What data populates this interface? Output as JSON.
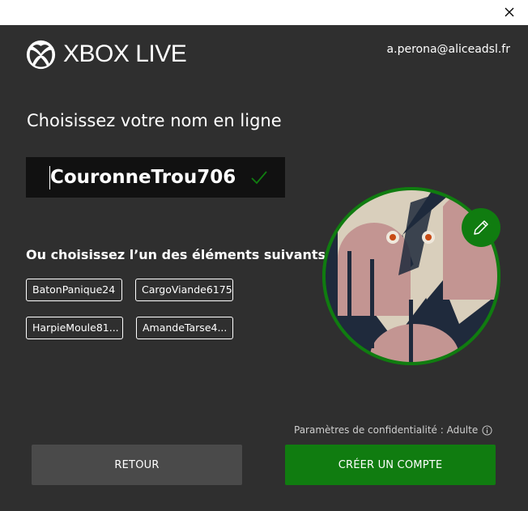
{
  "window": {
    "close_icon": "close-icon"
  },
  "header": {
    "logo_text": "XBOX LIVE",
    "logo_icon": "xbox-logo-icon",
    "email": "a.perona@aliceadsl.fr"
  },
  "main": {
    "heading": "Choisissez votre nom en ligne",
    "gamertag": {
      "value": "CouronneTrou706",
      "status_icon": "check-icon",
      "status_color": "#107c10"
    },
    "suggestions_heading": "Ou choisissez l’un des éléments suivants :",
    "suggestions": [
      "BatonPanique24",
      "CargoViande6175",
      "HarpieMoule81...",
      "AmandeTarse4..."
    ]
  },
  "avatar": {
    "edit_icon": "pencil-icon",
    "ring_color": "#107c10"
  },
  "footer": {
    "privacy_text": "Paramètres de confidentialité : Adulte",
    "privacy_icon": "info-icon",
    "back_label": "RETOUR",
    "create_label": "CRÉER UN COMPTE",
    "accent_color": "#107c10"
  }
}
